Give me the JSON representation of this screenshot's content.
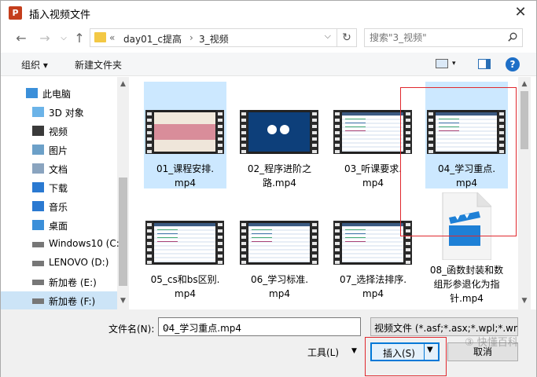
{
  "window": {
    "title": "插入视频文件",
    "app_icon_letter": "P",
    "close": "✕"
  },
  "nav": {
    "back": "←",
    "forward": "→",
    "up_dropdown": "⌵",
    "up": "↑"
  },
  "address": {
    "chevron": "«",
    "crumbs": [
      "day01_c提高",
      "3_视频"
    ],
    "sep": "›",
    "refresh": "↻"
  },
  "search": {
    "placeholder": "搜索\"3_视频\""
  },
  "toolbar": {
    "organize": "组织 ▾",
    "new_folder": "新建文件夹",
    "help": "?"
  },
  "navpane": {
    "items": [
      {
        "label": "此电脑",
        "icon": "computer-icon",
        "root": true,
        "selected": false
      },
      {
        "label": "3D 对象",
        "icon": "3d-objects-icon",
        "selected": false
      },
      {
        "label": "视频",
        "icon": "video-folder-icon",
        "selected": false
      },
      {
        "label": "图片",
        "icon": "pictures-icon",
        "selected": false
      },
      {
        "label": "文档",
        "icon": "documents-icon",
        "selected": false
      },
      {
        "label": "下载",
        "icon": "download-icon",
        "selected": false
      },
      {
        "label": "音乐",
        "icon": "music-icon",
        "selected": false
      },
      {
        "label": "桌面",
        "icon": "desktop-icon",
        "selected": false
      },
      {
        "label": "Windows10 (C:",
        "icon": "drive-icon",
        "selected": false
      },
      {
        "label": "LENOVO (D:)",
        "icon": "drive-icon",
        "selected": false
      },
      {
        "label": "新加卷 (E:)",
        "icon": "drive-icon",
        "selected": false
      },
      {
        "label": "新加卷 (F:)",
        "icon": "drive-icon",
        "selected": true
      }
    ]
  },
  "files": [
    {
      "name_l1": "01_课程安排.",
      "name_l2": "mp4",
      "selected": true,
      "thumb": "blurred"
    },
    {
      "name_l1": "02_程序进阶之",
      "name_l2": "路.mp4",
      "selected": false,
      "thumb": "blue"
    },
    {
      "name_l1": "03_听课要求.",
      "name_l2": "mp4",
      "selected": false,
      "thumb": "code"
    },
    {
      "name_l1": "04_学习重点.",
      "name_l2": "mp4",
      "selected": true,
      "thumb": "code"
    },
    {
      "name_l1": "05_cs和bs区别.",
      "name_l2": "mp4",
      "selected": false,
      "thumb": "code"
    },
    {
      "name_l1": "06_学习标准.",
      "name_l2": "mp4",
      "selected": false,
      "thumb": "code"
    },
    {
      "name_l1": "07_选择法排序.",
      "name_l2": "mp4",
      "selected": false,
      "thumb": "code"
    },
    {
      "name_l1": "08_函数封装和数",
      "name_l2": "组形参退化为指",
      "name_l3": "针.mp4",
      "selected": false,
      "thumb": "clapper"
    }
  ],
  "bottom": {
    "filename_label": "文件名(N):",
    "filename_value": "04_学习重点.mp4",
    "filetype": "视频文件 (*.asf;*.asx;*.wpl;*.wm",
    "tools": "工具(L)",
    "insert": "插入(S)",
    "cancel": "取消"
  },
  "watermark": "③ 快懂百科",
  "colors": {
    "accent": "#0078d7",
    "selection": "#cce8ff",
    "annotation": "#e0282e"
  }
}
